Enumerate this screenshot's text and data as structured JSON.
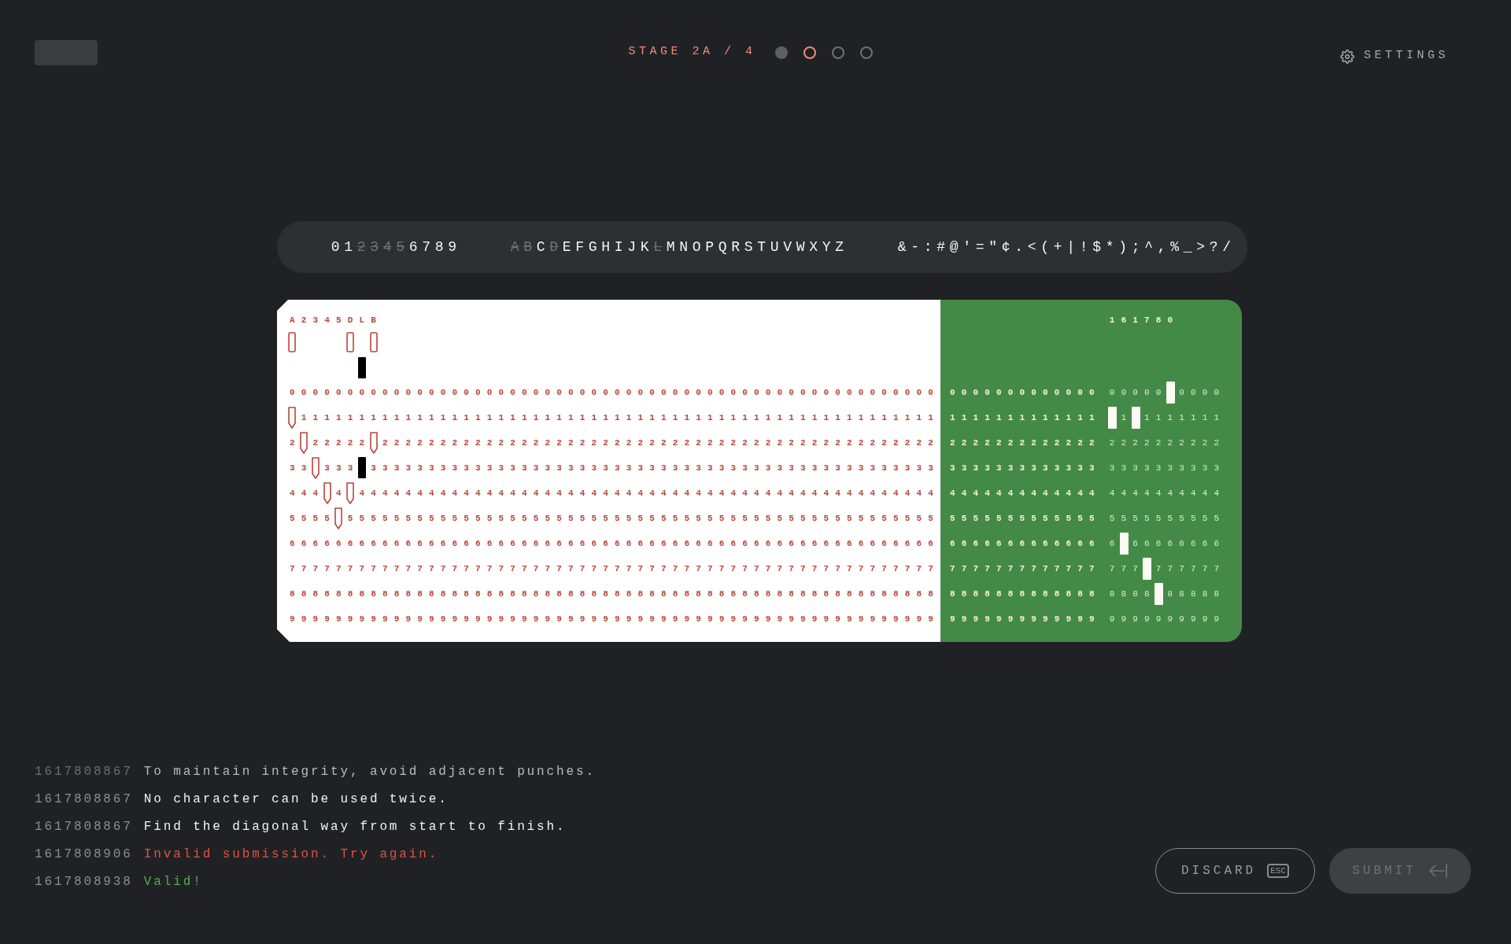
{
  "header": {
    "stage": "STAGE 2A / 4",
    "steps": [
      {
        "completed": true,
        "selected": false
      },
      {
        "completed": false,
        "selected": true
      },
      {
        "completed": false,
        "selected": false
      },
      {
        "completed": false,
        "selected": false
      }
    ],
    "settings": "SETTINGS"
  },
  "charset": [
    {
      "chars": [
        {
          "char": "0",
          "used": false
        },
        {
          "char": "1",
          "used": false
        },
        {
          "char": "2",
          "used": true
        },
        {
          "char": "3",
          "used": true
        },
        {
          "char": "4",
          "used": true
        },
        {
          "char": "5",
          "used": true
        },
        {
          "char": "6",
          "used": false
        },
        {
          "char": "7",
          "used": false
        },
        {
          "char": "8",
          "used": false
        },
        {
          "char": "9",
          "used": false
        }
      ]
    },
    {
      "chars": [
        {
          "char": "A",
          "used": true
        },
        {
          "char": "B",
          "used": true
        },
        {
          "char": "C",
          "used": false
        },
        {
          "char": "D",
          "used": true
        },
        {
          "char": "E",
          "used": false
        },
        {
          "char": "F",
          "used": false
        },
        {
          "char": "G",
          "used": false
        },
        {
          "char": "H",
          "used": false
        },
        {
          "char": "I",
          "used": false
        },
        {
          "char": "J",
          "used": false
        },
        {
          "char": "K",
          "used": false
        },
        {
          "char": "L",
          "used": true
        },
        {
          "char": "M",
          "used": false
        },
        {
          "char": "N",
          "used": false
        },
        {
          "char": "O",
          "used": false
        },
        {
          "char": "P",
          "used": false
        },
        {
          "char": "Q",
          "used": false
        },
        {
          "char": "R",
          "used": false
        },
        {
          "char": "S",
          "used": false
        },
        {
          "char": "T",
          "used": false
        },
        {
          "char": "U",
          "used": false
        },
        {
          "char": "V",
          "used": false
        },
        {
          "char": "W",
          "used": false
        },
        {
          "char": "X",
          "used": false
        },
        {
          "char": "Y",
          "used": false
        },
        {
          "char": "Z",
          "used": false
        }
      ]
    },
    {
      "chars": [
        {
          "char": "&",
          "used": false
        },
        {
          "char": "-",
          "used": false
        },
        {
          "char": ":",
          "used": false
        },
        {
          "char": "#",
          "used": false
        },
        {
          "char": "@",
          "used": false
        },
        {
          "char": "'",
          "used": false
        },
        {
          "char": "=",
          "used": false
        },
        {
          "char": "\"",
          "used": false
        },
        {
          "char": "¢",
          "used": false
        },
        {
          "char": ".",
          "used": false
        },
        {
          "char": "<",
          "used": false
        },
        {
          "char": "(",
          "used": false
        },
        {
          "char": "+",
          "used": false
        },
        {
          "char": "|",
          "used": false
        },
        {
          "char": "!",
          "used": false
        },
        {
          "char": "$",
          "used": false
        },
        {
          "char": "*",
          "used": false
        },
        {
          "char": ")",
          "used": false
        },
        {
          "char": ";",
          "used": false
        },
        {
          "char": "^",
          "used": false
        },
        {
          "char": ",",
          "used": false
        },
        {
          "char": "%",
          "used": false
        },
        {
          "char": "_",
          "used": false
        },
        {
          "char": ">",
          "used": false
        },
        {
          "char": "?",
          "used": false
        },
        {
          "char": "/",
          "used": false
        }
      ]
    }
  ],
  "card": {
    "sections": [
      {
        "kind": "white",
        "groups": [
          {
            "kind": "outline",
            "header": "A2345DLB",
            "columns": [
              {
                "kind": "outline",
                "top_punch": true
              },
              {
                "kind": "outline"
              },
              {
                "kind": "outline"
              },
              {
                "kind": "outline"
              },
              {
                "kind": "outline"
              },
              {
                "kind": "outline",
                "top_punch": true
              },
              {
                "kind": "filled",
                "upper_punch": true
              },
              {
                "kind": "outline",
                "top_punch": true
              }
            ],
            "rows": [
              "00000000000000000000000000000000000000000000000000000000",
              " 1111111111111111111111111111111111111111111111111111111",
              "2 22222 222222222222222222222222222222222222222222222222",
              "33 333 3333333333333333333333333333333333333333333333333",
              "444 4 44444444444444444444444444444444444444444444444444",
              "5555 555555555555555555555555555555555555555555555555555",
              "66666666666666666666666666666666666666666666666666666666",
              "77777777777777777777777777777777777777777777777777777777",
              "88888888888888888888888888888888888888888888888888888888",
              "99999999999999999999999999999999999999999999999999999999"
            ]
          }
        ]
      },
      {
        "kind": "green",
        "groups": [
          {
            "kind": "plain",
            "rows": [
              "0000000000000",
              "1111111111111",
              "2222222222222",
              "3333333333333",
              "4444444444444",
              "5555555555555",
              "6666666666666",
              "7777777777777",
              "8888888888888",
              "9999999999999"
            ]
          },
          {
            "kind": "solid",
            "header": "161780",
            "rows": [
              "00000 0000",
              " 1 1111111",
              "2222222222",
              "3333333333",
              "4444444444",
              "5555555555",
              "6 66666666",
              "777 777777",
              "8888 88888",
              "9999999999"
            ]
          }
        ]
      }
    ]
  },
  "log": [
    {
      "time": "1617808867",
      "message": "To maintain integrity, avoid adjacent punches.",
      "kind": "faded"
    },
    {
      "time": "1617808867",
      "message": "No character can be used twice.",
      "kind": "rule"
    },
    {
      "time": "1617808867",
      "message": "Find the diagonal way from start to finish.",
      "kind": "rule"
    },
    {
      "time": "1617808906",
      "message": "Invalid submission. Try again.",
      "kind": "error"
    },
    {
      "time": "1617808938",
      "message": "Valid!",
      "kind": "success"
    }
  ],
  "actions": {
    "discard": {
      "label": "DISCARD",
      "key": "ESC"
    },
    "submit": {
      "label": "SUBMIT",
      "disabled": true
    }
  }
}
